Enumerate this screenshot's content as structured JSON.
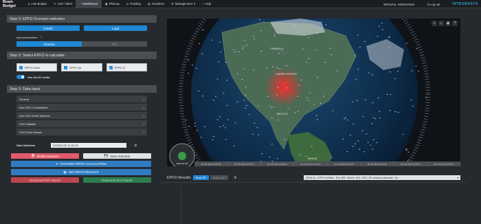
{
  "app": {
    "brand": "Beam Budget"
  },
  "nav": {
    "items": [
      {
        "label": "Link Budget",
        "icon": "circle-icon",
        "active": false
      },
      {
        "label": "LEO / MEO",
        "icon": "satellite-icon",
        "active": false
      },
      {
        "label": "Interference",
        "icon": "antenna-icon",
        "active": true
      },
      {
        "label": "PfeiCop",
        "icon": "camera-icon",
        "active": false
      },
      {
        "label": "Pointing",
        "icon": "target-icon",
        "active": false
      },
      {
        "label": "Visualizer",
        "icon": "chart-icon",
        "active": false
      },
      {
        "label": "Management",
        "icon": "gear-icon",
        "active": false
      },
      {
        "label": "Help",
        "icon": "question-icon",
        "active": false
      }
    ],
    "management_chevron": "▾"
  },
  "header_right": {
    "welcome": "Welcome, Administrator",
    "logout": "Log out",
    "logo": "INTEGRASYS"
  },
  "step2": {
    "title": "Step 2: EPFD Scenario selection",
    "create_label": "Create",
    "load_label": "Load",
    "input_params_label": "Input parameters",
    "industry_label": "Industry",
    "itu_label": "ITU"
  },
  "step2b": {
    "title": "Step 2: Select EPFD to calculate",
    "options": [
      {
        "label": "EPFD Down",
        "checked": true
      },
      {
        "label": "EPFD Up",
        "checked": true
      },
      {
        "label": "EPFD IS",
        "checked": true
      }
    ],
    "toggle_label": "Use Art.22 Limits"
  },
  "step3": {
    "title": "Step 3: Data input",
    "sections": [
      "General",
      "Non-GSO Constellation",
      "Non-GSO Earth Station/s",
      "GSO Satellite",
      "GSO Earth Station"
    ]
  },
  "datetime": {
    "label": "Start Datetime",
    "value": "2023/01/25 10:02:45"
  },
  "actions": {
    "delete_label": "Delete Scenario",
    "save_label": "Save Scenario",
    "dynamic_label": "DYNAMIC EPFD CALCULATION",
    "get_results_label": "GET EPFD RESULTS",
    "pdf_label": "Download PDF Report",
    "xls_label": "Download XLS Report"
  },
  "map": {
    "controls": [
      "⌕",
      "⌂",
      "◉",
      "?"
    ],
    "timeline_ticks": [
      "Jan 25 2023 10:00:00",
      "Jan 25 2023 10:04:00",
      "Jan 25 2023 10:08:00",
      "Jan 25 2023 10:12:00",
      "Jan 25 2023 10:16:00",
      "Jan 25 2023 10:20:00",
      "Jan 25 2023 10:24:00",
      "Jan 25 2023 10:28:00"
    ],
    "clock_text": "2023 Jan 25",
    "labels": [
      "UNITED STATES",
      "MEXICO",
      "CANADA",
      "BRASIL"
    ],
    "colors": {
      "ocean": "#0d2a47",
      "land": "#4b6b55",
      "sat": "#cfd6ff",
      "beam": "#ff2020"
    }
  },
  "results": {
    "title": "EPFD Results",
    "tab_plot": "Peak EP",
    "tab_table": "Summ. EP",
    "select_value": "[RUN 1] - EPFD DOWN - Ref. BW: 40kHz, Ref. GSO_ES antenna diameter: 1m"
  }
}
